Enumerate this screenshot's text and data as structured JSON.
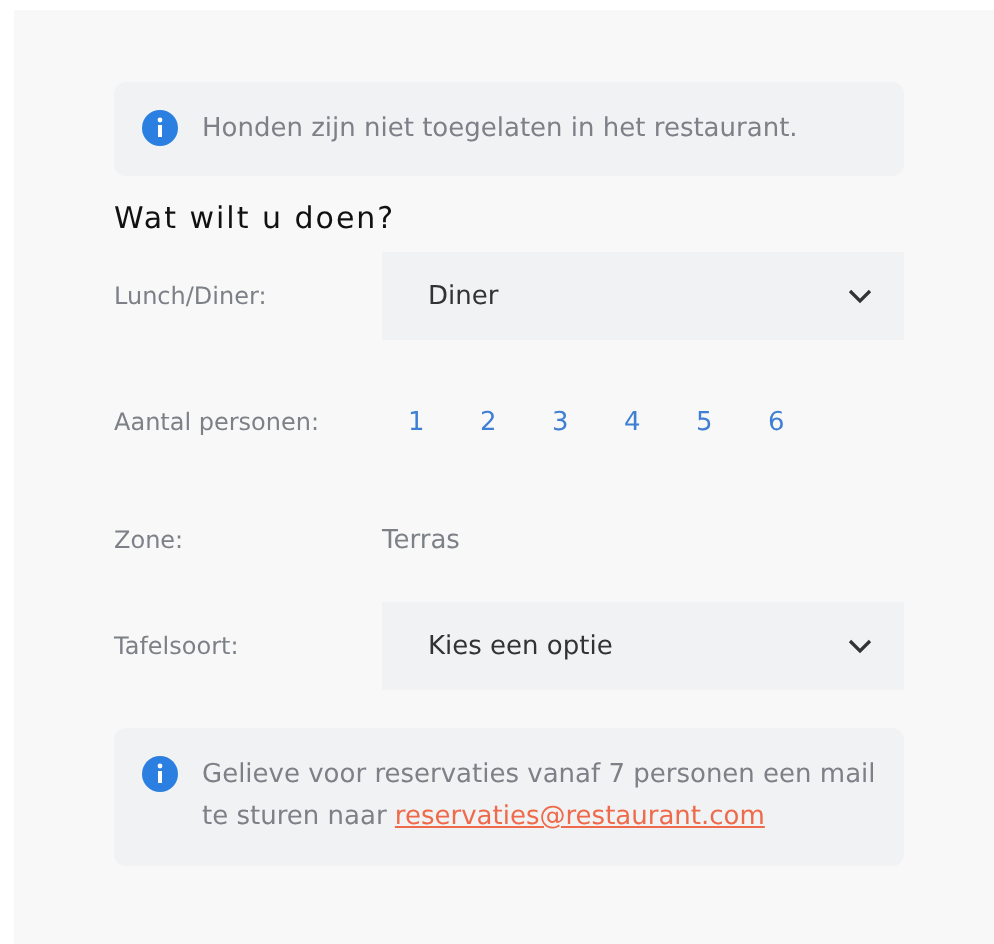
{
  "notice": {
    "text": "Honden zijn niet toegelaten in het restaurant."
  },
  "heading": "Wat wilt u doen?",
  "rows": [
    {
      "kind": "select",
      "label": "Lunch/Diner:",
      "value": "Diner"
    },
    {
      "kind": "numbers",
      "label": "Aantal personen:",
      "options": [
        "1",
        "2",
        "3",
        "4",
        "5",
        "6"
      ]
    },
    {
      "kind": "text",
      "label": "Zone:",
      "value": "Terras"
    },
    {
      "kind": "select",
      "label": "Tafelsoort:",
      "value": "Kies een optie"
    }
  ],
  "footer_note": {
    "text": "Gelieve voor reservaties vanaf 7 personen een mail te sturen naar ",
    "link": "reservaties@restaurant.com"
  }
}
